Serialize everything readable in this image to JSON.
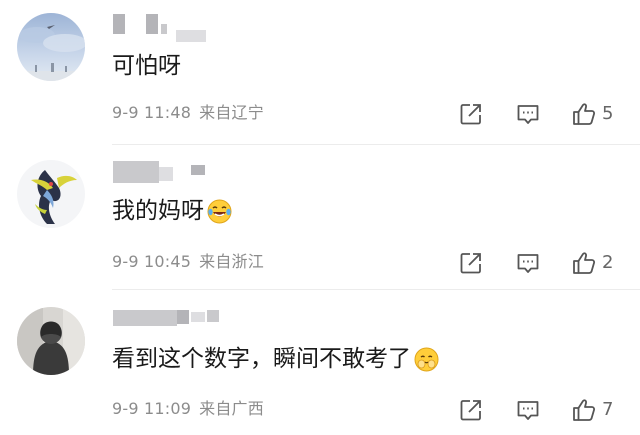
{
  "comments": [
    {
      "avatar": "sky-photo-avatar",
      "text": "可怕呀",
      "emoji": null,
      "date": "9-9 11:48",
      "location": "来自辽宁",
      "likes": "5",
      "share_icon": "share-icon",
      "reply_icon": "comment-icon",
      "like_icon": "thumbs-up-icon"
    },
    {
      "avatar": "anime-character-avatar",
      "text": "我的妈呀",
      "emoji": "laughing-crying-emoji",
      "date": "9-9 10:45",
      "location": "来自浙江",
      "likes": "2",
      "share_icon": "share-icon",
      "reply_icon": "comment-icon",
      "like_icon": "thumbs-up-icon"
    },
    {
      "avatar": "dark-figure-avatar",
      "text": "看到这个数字，瞬间不敢考了",
      "emoji": "praying-hands-face-emoji",
      "date": "9-9 11:09",
      "location": "来自广西",
      "likes": "7",
      "share_icon": "share-icon",
      "reply_icon": "comment-icon",
      "like_icon": "thumbs-up-icon"
    }
  ],
  "colors": {
    "text": "#1a1a1a",
    "meta": "#8c8c8c",
    "icon": "#555555",
    "divider": "#ececec"
  }
}
